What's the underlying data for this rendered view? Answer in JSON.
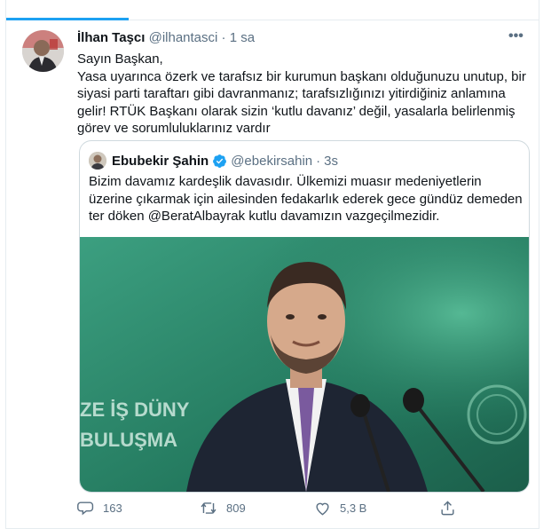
{
  "tab_strip": {
    "partial_text": "· · · · ·"
  },
  "tweet": {
    "author_name": "İlhan Taşcı",
    "author_handle": "@ilhantasci",
    "separator": "·",
    "time": "1 sa",
    "more_label": "•••",
    "lines": [
      "Sayın Başkan,",
      "Yasa uyarınca özerk ve tarafsız bir kurumun başkanı olduğunuzu unutup, bir siyasi parti taraftarı gibi davranmanız; tarafsızlığınızı yitirdiğiniz anlamına gelir! RTÜK Başkanı olarak sizin ‘kutlu davanız’ değil, yasalarla belirlenmiş görev ve sorumluluklarınız vardır"
    ],
    "quoted": {
      "author_name": "Ebubekir Şahin",
      "author_handle": "@ebekirsahin",
      "separator": "·",
      "time": "3s",
      "text": "Bizim davamız kardeşlik davasıdır. Ülkemizi muasır medeniyetlerin üzerine çıkarmak için ailesinden fedakarlık ederek gece gündüz demeden ter döken @BeratAlbayrak kutlu davamızın vazgeçilmezidir.",
      "image_backdrop_text": [
        "ZE İŞ DÜNY",
        "BULUŞMA"
      ]
    },
    "actions": {
      "reply_count": "163",
      "retweet_count": "809",
      "like_count": "5,3 B"
    }
  },
  "colors": {
    "accent": "#1da1f2",
    "text_primary": "#0f1419",
    "text_secondary": "#5b7083",
    "border": "#cfd9de",
    "backdrop_green": "#2e8a6c"
  }
}
